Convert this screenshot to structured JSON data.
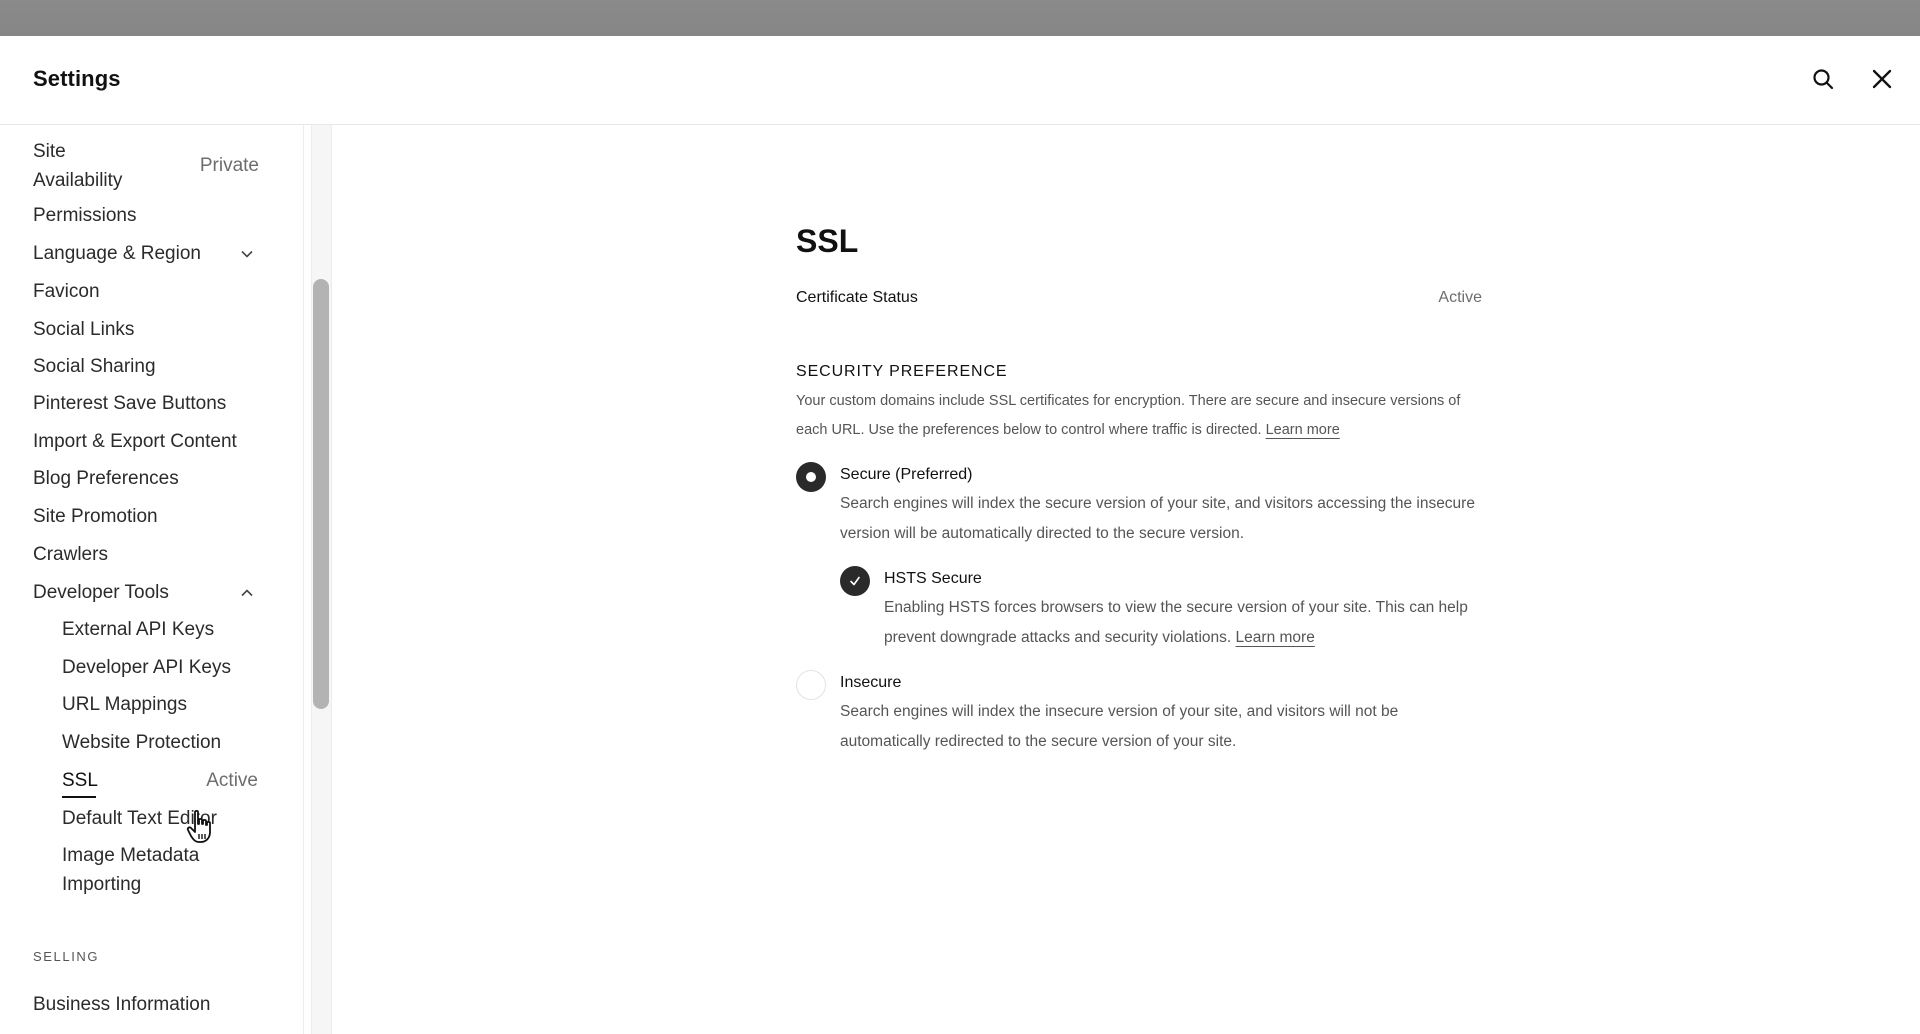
{
  "header": {
    "title": "Settings",
    "search_icon": "search-icon",
    "close_icon": "close-icon"
  },
  "sidebar": {
    "items": [
      {
        "label": "Site\nAvailability",
        "status": "Private"
      },
      {
        "label": "Permissions"
      },
      {
        "label": "Language & Region",
        "chevron": "chevron-down-icon"
      },
      {
        "label": "Favicon"
      },
      {
        "label": "Social Links"
      },
      {
        "label": "Social Sharing"
      },
      {
        "label": "Pinterest Save Buttons"
      },
      {
        "label": "Import & Export Content"
      },
      {
        "label": "Blog Preferences"
      },
      {
        "label": "Site Promotion"
      },
      {
        "label": "Crawlers"
      },
      {
        "label": "Developer Tools",
        "chevron": "chevron-up-icon"
      }
    ],
    "developer_tools_items": [
      {
        "label": "External API Keys"
      },
      {
        "label": "Developer API Keys"
      },
      {
        "label": "URL Mappings"
      },
      {
        "label": "Website Protection"
      },
      {
        "label": "SSL",
        "status": "Active",
        "active": true
      },
      {
        "label": "Default Text Editor"
      },
      {
        "label": "Image Metadata\nImporting"
      }
    ],
    "section_selling": "SELLING",
    "selling_items": [
      {
        "label": "Business Information"
      }
    ]
  },
  "main": {
    "title": "SSL",
    "certificate": {
      "label": "Certificate Status",
      "value": "Active"
    },
    "security_preference": {
      "heading": "SECURITY PREFERENCE",
      "description": "Your custom domains include SSL certificates for encryption. There are secure and insecure versions of each URL. Use the preferences below to control where traffic is directed.",
      "learn_more": "Learn more",
      "options": [
        {
          "title": "Secure (Preferred)",
          "description": "Search engines will index the secure version of your site, and visitors accessing the insecure version will be automatically directed to the secure version.",
          "selected": true
        },
        {
          "title": "Insecure",
          "description": "Search engines will index the insecure version of your site, and visitors will not be automatically redirected to the secure version of your site.",
          "selected": false
        }
      ],
      "hsts": {
        "title": "HSTS Secure",
        "description": "Enabling HSTS forces browsers to view the secure version of your site. This can help prevent downgrade attacks and security violations.",
        "learn_more": "Learn more",
        "checked": true
      }
    }
  },
  "colors": {
    "text_primary": "#111111",
    "text_secondary": "#555555",
    "control_dark": "#2a2a2a",
    "overlay": "#888888"
  }
}
